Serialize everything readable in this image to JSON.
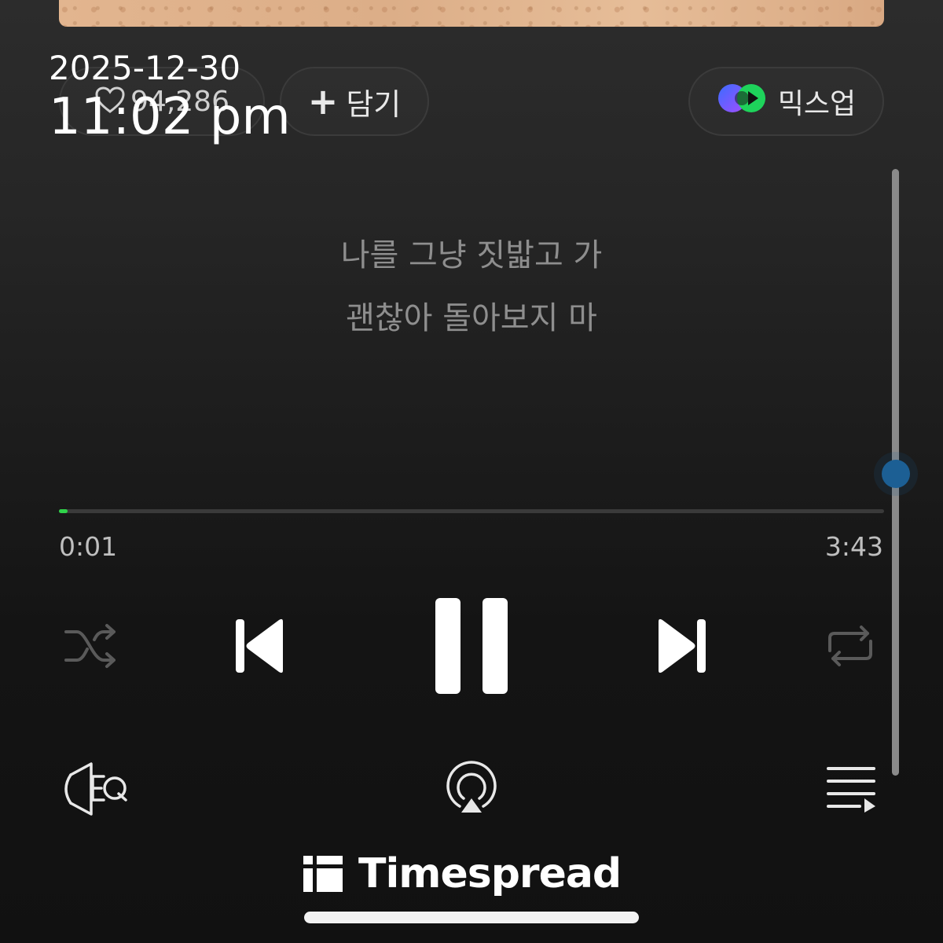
{
  "overlay": {
    "date": "2025-12-30",
    "time": "11:02 pm"
  },
  "actions": {
    "like_count": "94,286",
    "add_label": "담기",
    "mixup_label": "믹스업"
  },
  "lyrics": [
    "나를 그냥 짓밟고 가",
    "괜찮아 돌아보지 마"
  ],
  "player": {
    "elapsed": "0:01",
    "duration": "3:43",
    "progress_percent": 0.5
  },
  "icons": {
    "like": "heart-outline-icon",
    "add": "plus-icon",
    "mixup": "mixup-logo-icon",
    "shuffle": "shuffle-icon",
    "previous": "skip-previous-icon",
    "pause": "pause-icon",
    "next": "skip-next-icon",
    "repeat": "repeat-icon",
    "equalizer": "eq-icon",
    "airplay": "airplay-icon",
    "playlist": "playlist-icon"
  },
  "watermark": {
    "text": "Timespread"
  },
  "colors": {
    "progress": "#2fd34a",
    "scroll_thumb": "#1c5f94",
    "background": "#1a1a1a"
  }
}
